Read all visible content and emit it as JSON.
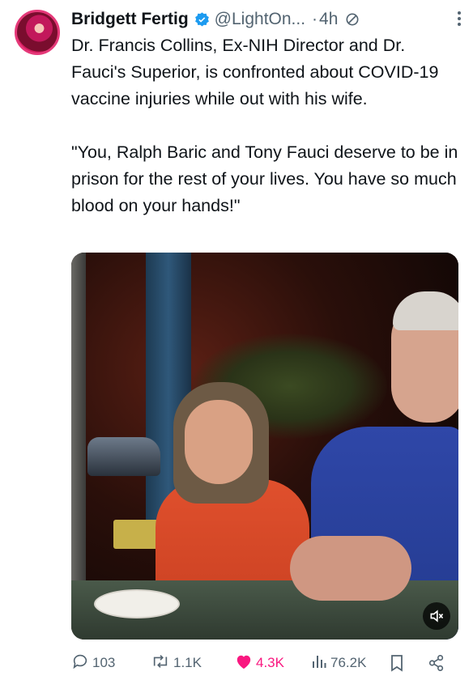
{
  "author": {
    "display_name": "Bridgett Fertig",
    "handle": "@LightOn...",
    "separator": "·",
    "time": "4h"
  },
  "tweet": {
    "paragraph1": "Dr. Francis Collins, Ex-NIH Director and Dr. Fauci's Superior, is confronted about COVID-19 vaccine injuries while out with his wife.",
    "paragraph2": "\"You, Ralph Baric and Tony Fauci deserve to be in prison for the rest of your lives. You have so much blood on your hands!\""
  },
  "metrics": {
    "replies": "103",
    "reposts": "1.1K",
    "likes": "4.3K",
    "views": "76.2K"
  },
  "colors": {
    "verified": "#1d9bf0",
    "like_active": "#f91880",
    "secondary_text": "#536471",
    "primary_text": "#0f1419"
  },
  "icons": {
    "verified": "verified-badge-icon",
    "edited": "edited-icon",
    "more": "more-icon",
    "mute": "mute-icon",
    "reply": "reply-icon",
    "repost": "repost-icon",
    "like": "heart-icon",
    "views": "views-icon",
    "bookmark": "bookmark-icon",
    "share": "share-icon"
  }
}
